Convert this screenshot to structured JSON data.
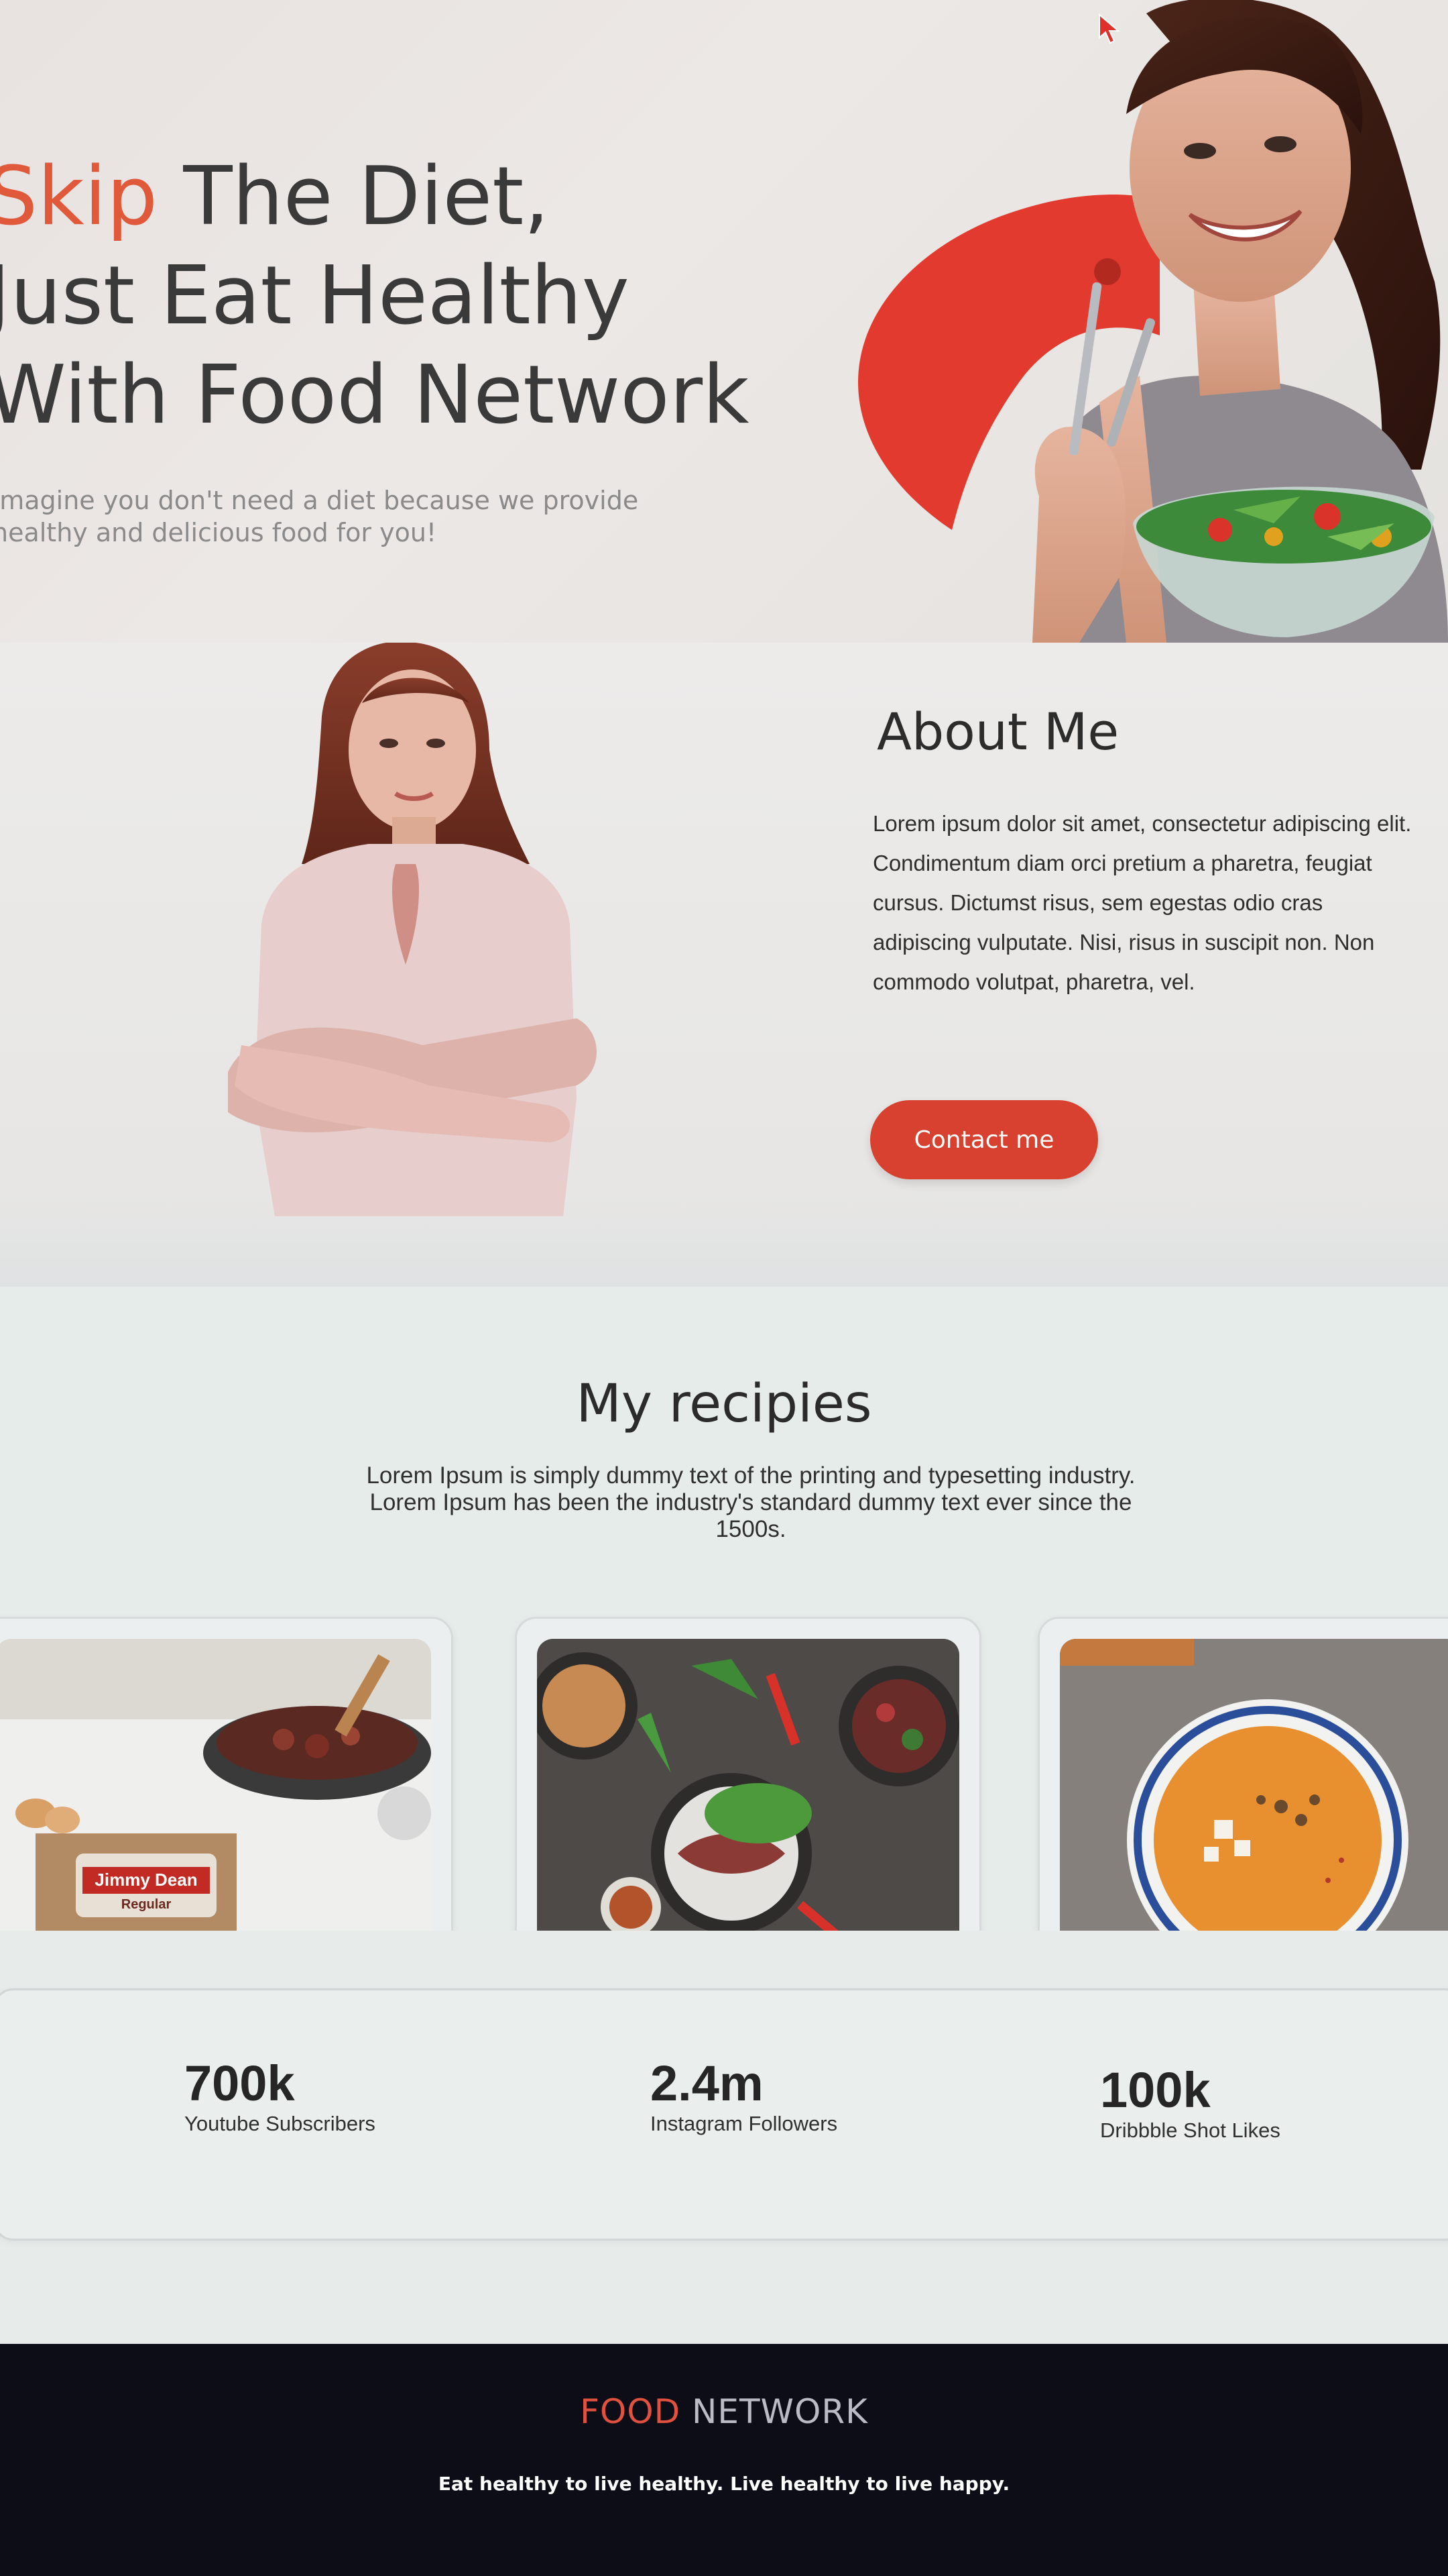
{
  "hero": {
    "title_accent": "Skip",
    "title_rest_line1": " The Diet,",
    "title_line2": "Just Eat Healthy",
    "title_line3": "With Food Network",
    "subtitle": "Imagine you don't need a diet because we provide healthy and delicious food for you!"
  },
  "about": {
    "heading": "About Me",
    "body": "Lorem ipsum dolor sit amet, consectetur adipiscing elit. Condimentum diam orci pretium a pharetra, feugiat cursus. Dictumst risus, sem egestas odio cras adipiscing vulputate. Nisi, risus in suscipit non. Non commodo volutpat, pharetra, vel.",
    "button_label": "Contact me"
  },
  "recipes": {
    "heading": "My recipies",
    "description": "Lorem Ipsum is simply dummy text of the printing and typesetting industry. Lorem Ipsum has been the industry's standard dummy text ever since the 1500s.",
    "package_label_1": "Jimmy Dean",
    "package_label_2": "Regular"
  },
  "stats": [
    {
      "value": "700k",
      "label": "Youtube Subscribers"
    },
    {
      "value": "2.4m",
      "label": "Instagram Followers"
    },
    {
      "value": "100k",
      "label": "Dribbble Shot Likes"
    }
  ],
  "footer": {
    "brand_accent": "FOOD",
    "brand_rest": " NETWORK",
    "tagline": "Eat healthy to live healthy. Live healthy to live happy."
  },
  "colors": {
    "accent": "#e0593a",
    "button": "#d8412f",
    "footer_bg": "#0c0d16"
  }
}
